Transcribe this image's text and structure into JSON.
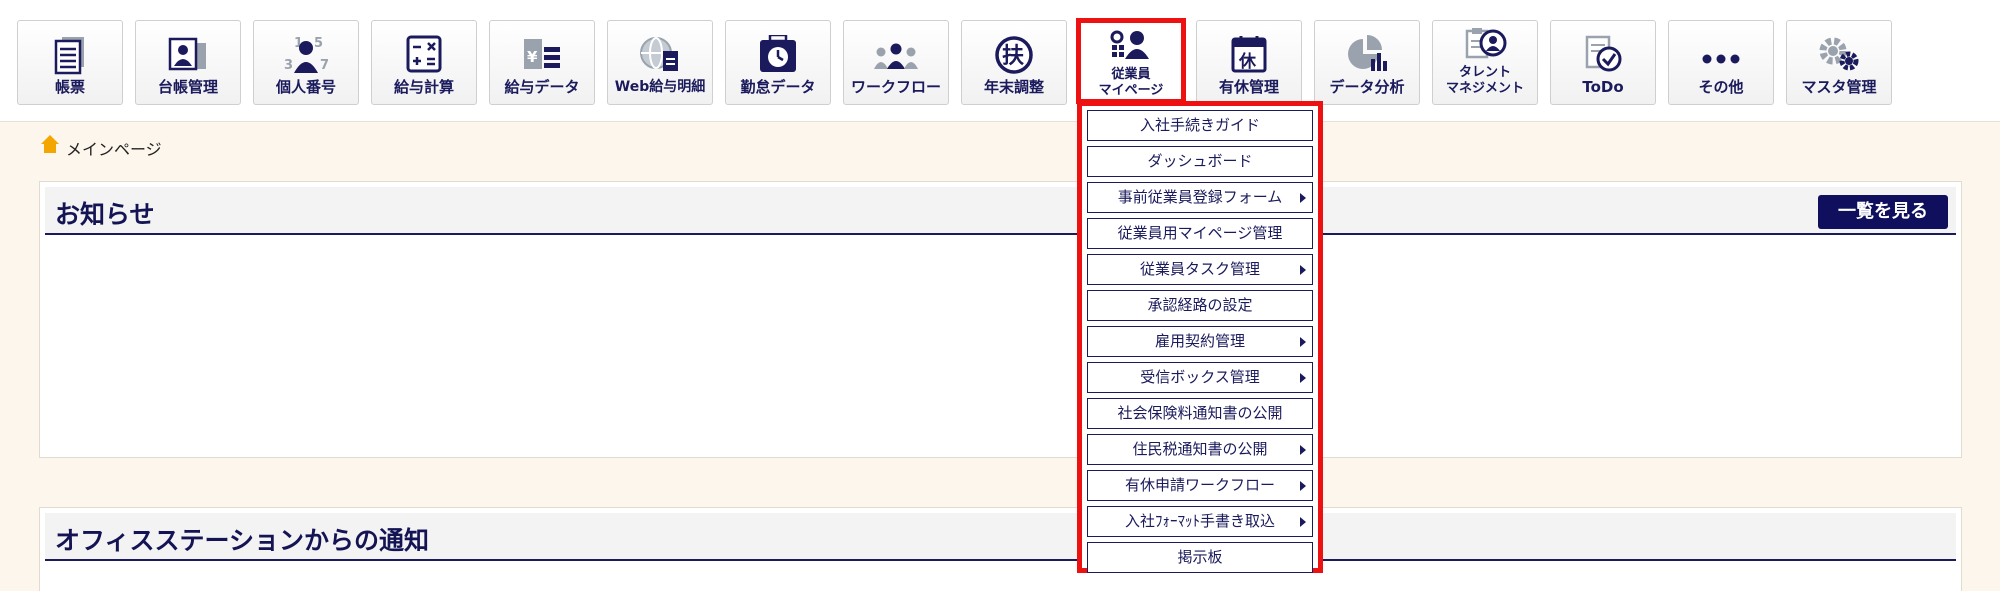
{
  "toolbar": {
    "items": [
      {
        "label": "帳票",
        "icon": "document-list-icon"
      },
      {
        "label": "台帳管理",
        "icon": "ledger-icon"
      },
      {
        "label": "個人番号",
        "icon": "personal-number-icon"
      },
      {
        "label": "給与計算",
        "icon": "calculator-icon"
      },
      {
        "label": "給与データ",
        "icon": "yen-data-icon"
      },
      {
        "label": "Web給与明細",
        "icon": "web-payslip-icon"
      },
      {
        "label": "勤怠データ",
        "icon": "attendance-clock-icon"
      },
      {
        "label": "ワークフロー",
        "icon": "workflow-people-icon"
      },
      {
        "label": "年末調整",
        "icon": "year-end-fu-icon"
      },
      {
        "label_line1": "従業員",
        "label_line2": "マイページ",
        "icon": "employee-mypage-icon",
        "active": true
      },
      {
        "label": "有休管理",
        "icon": "paid-leave-calendar-icon",
        "badge": "休"
      },
      {
        "label": "データ分析",
        "icon": "data-analysis-icon"
      },
      {
        "label_line1": "タレント",
        "label_line2": "マネジメント",
        "icon": "talent-management-icon"
      },
      {
        "label": "ToDo",
        "icon": "todo-check-icon"
      },
      {
        "label": "その他",
        "icon": "more-dots-icon"
      },
      {
        "label": "マスタ管理",
        "icon": "master-gear-icon"
      }
    ]
  },
  "breadcrumb": {
    "label": "メインページ",
    "icon": "home-icon"
  },
  "notices": {
    "title": "お知らせ",
    "list_button": "一覧を見る"
  },
  "office_station": {
    "title": "オフィスステーションからの通知"
  },
  "dropdown": {
    "items": [
      {
        "label": "入社手続きガイド",
        "submenu": false
      },
      {
        "label": "ダッシュボード",
        "submenu": false
      },
      {
        "label": "事前従業員登録フォーム",
        "submenu": true
      },
      {
        "label": "従業員用マイページ管理",
        "submenu": false
      },
      {
        "label": "従業員タスク管理",
        "submenu": true
      },
      {
        "label": "承認経路の設定",
        "submenu": false
      },
      {
        "label": "雇用契約管理",
        "submenu": true
      },
      {
        "label": "受信ボックス管理",
        "submenu": true
      },
      {
        "label": "社会保険料通知書の公開",
        "submenu": false
      },
      {
        "label": "住民税通知書の公開",
        "submenu": true
      },
      {
        "label": "有休申請ワークフロー",
        "submenu": true
      },
      {
        "label": "入社ﾌｫｰﾏｯﾄ手書き取込",
        "submenu": true
      },
      {
        "label": "掲示板",
        "submenu": false
      }
    ]
  },
  "colors": {
    "accent": "#1a1a5c",
    "highlight": "#ee1111",
    "icon_dark": "#1a1a5c",
    "icon_light": "#9aa3ad"
  }
}
